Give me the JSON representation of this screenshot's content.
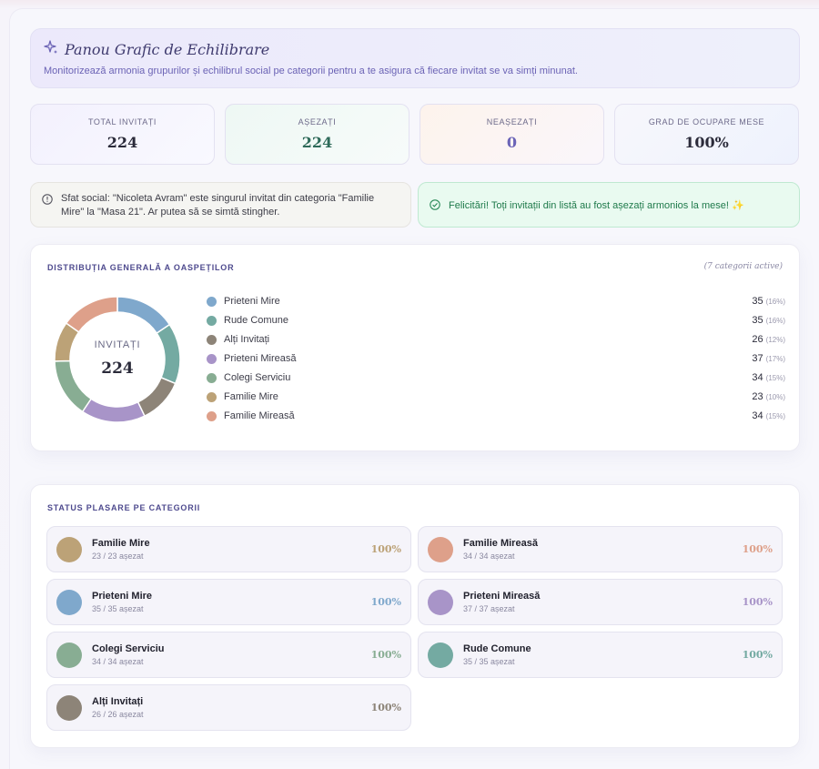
{
  "banner": {
    "title": "Panou Grafic de Echilibrare",
    "subtitle": "Monitorizează armonia grupurilor și echilibrul social pe categorii pentru a te asigura că fiecare invitat se va simți minunat."
  },
  "stats": [
    {
      "label": "TOTAL INVITAȚI",
      "value": "224"
    },
    {
      "label": "AȘEZAȚI",
      "value": "224"
    },
    {
      "label": "NEAȘEZAȚI",
      "value": "0"
    },
    {
      "label": "GRAD DE OCUPARE MESE",
      "value": "100%"
    }
  ],
  "tip": {
    "text": "Sfat social: \"Nicoleta Avram\" este singurul invitat din categoria \"Familie Mire\" la \"Masa 21\". Ar putea să se simtă stingher."
  },
  "success": {
    "text": "Felicitări! Toți invitații din listă au fost așezați armonios la mese! ✨"
  },
  "distribution": {
    "title": "DISTRIBUȚIA GENERALĂ A OASPEȚILOR",
    "active": "(7 categorii active)",
    "center_label": "INVITAȚI",
    "center_value": "224",
    "legend": [
      {
        "name": "Prieteni Mire",
        "count": "35",
        "pct": "(16%)"
      },
      {
        "name": "Rude Comune",
        "count": "35",
        "pct": "(16%)"
      },
      {
        "name": "Alți Invitați",
        "count": "26",
        "pct": "(12%)"
      },
      {
        "name": "Prieteni Mireasă",
        "count": "37",
        "pct": "(17%)"
      },
      {
        "name": "Colegi Serviciu",
        "count": "34",
        "pct": "(15%)"
      },
      {
        "name": "Familie Mire",
        "count": "23",
        "pct": "(10%)"
      },
      {
        "name": "Familie Mireasă",
        "count": "34",
        "pct": "(15%)"
      }
    ]
  },
  "chart_data": {
    "type": "pie",
    "categories": [
      "Prieteni Mire",
      "Rude Comune",
      "Alți Invitați",
      "Prieteni Mireasă",
      "Colegi Serviciu",
      "Familie Mire",
      "Familie Mireasă"
    ],
    "values": [
      35,
      35,
      26,
      37,
      34,
      23,
      34
    ],
    "colors": [
      "#7fa8cc",
      "#74aaa2",
      "#8d8478",
      "#a894c8",
      "#88ad93",
      "#bca277",
      "#dea08a"
    ]
  },
  "placement": {
    "title": "STATUS PLASARE PE CATEGORII",
    "items": [
      {
        "name": "Familie Mire",
        "seated": "23 / 23 așezat",
        "pct": "100%",
        "color": "#bca277"
      },
      {
        "name": "Familie Mireasă",
        "seated": "34 / 34 așezat",
        "pct": "100%",
        "color": "#dea08a"
      },
      {
        "name": "Prieteni Mire",
        "seated": "35 / 35 așezat",
        "pct": "100%",
        "color": "#7fa8cc"
      },
      {
        "name": "Prieteni Mireasă",
        "seated": "37 / 37 așezat",
        "pct": "100%",
        "color": "#a894c8"
      },
      {
        "name": "Colegi Serviciu",
        "seated": "34 / 34 așezat",
        "pct": "100%",
        "color": "#88ad93"
      },
      {
        "name": "Rude Comune",
        "seated": "35 / 35 așezat",
        "pct": "100%",
        "color": "#74aaa2"
      },
      {
        "name": "Alți Invitați",
        "seated": "26 / 26 așezat",
        "pct": "100%",
        "color": "#8d8478"
      }
    ]
  }
}
